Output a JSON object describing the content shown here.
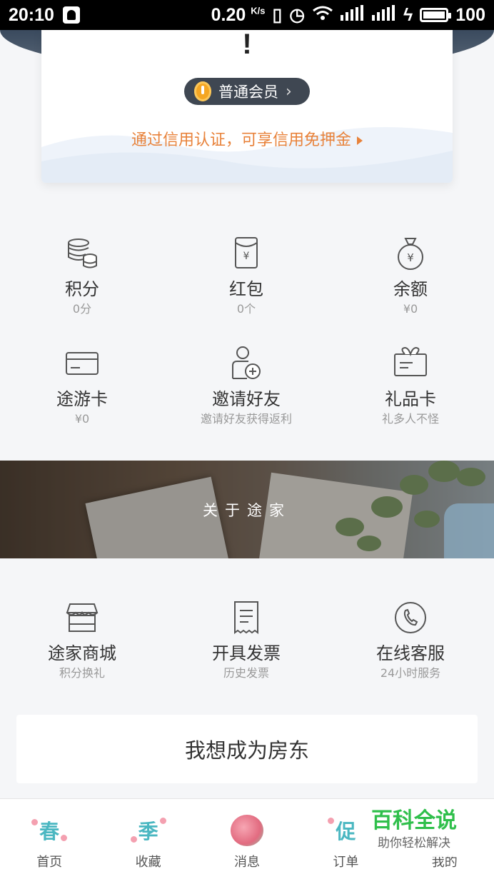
{
  "status_bar": {
    "time": "20:10",
    "speed": "0.20",
    "speed_unit": "K/s",
    "battery": "100"
  },
  "member_card": {
    "exclaim": "!",
    "level": "普通会员",
    "credit_link": "通过信用认证，可享信用免押金"
  },
  "wallet": [
    {
      "label": "积分",
      "sub": "0分",
      "icon": "coins-icon"
    },
    {
      "label": "红包",
      "sub": "0个",
      "icon": "red-envelope-icon"
    },
    {
      "label": "余额",
      "sub": "¥0",
      "icon": "money-bag-icon"
    },
    {
      "label": "途游卡",
      "sub": "¥0",
      "icon": "card-icon"
    },
    {
      "label": "邀请好友",
      "sub": "邀请好友获得返利",
      "icon": "invite-friend-icon"
    },
    {
      "label": "礼品卡",
      "sub": "礼多人不怪",
      "icon": "gift-card-icon"
    }
  ],
  "about": {
    "title": "关于途家"
  },
  "services": [
    {
      "label": "途家商城",
      "sub": "积分换礼",
      "icon": "store-icon"
    },
    {
      "label": "开具发票",
      "sub": "历史发票",
      "icon": "invoice-icon"
    },
    {
      "label": "在线客服",
      "sub": "24小时服务",
      "icon": "phone-icon"
    }
  ],
  "landlord_button": "我想成为房东",
  "tabs": [
    {
      "label": "首页",
      "glyph": "春"
    },
    {
      "label": "收藏",
      "glyph": "季"
    },
    {
      "label": "消息",
      "glyph": ""
    },
    {
      "label": "订单",
      "glyph": "促"
    },
    {
      "label": "我的",
      "glyph": ""
    }
  ],
  "watermark": {
    "title": "百科全说",
    "subtitle": "助你轻松解决"
  },
  "colors": {
    "accent_orange": "#e8823a",
    "badge_bg": "#3f4752",
    "watermark_green": "#2fbf4b"
  }
}
